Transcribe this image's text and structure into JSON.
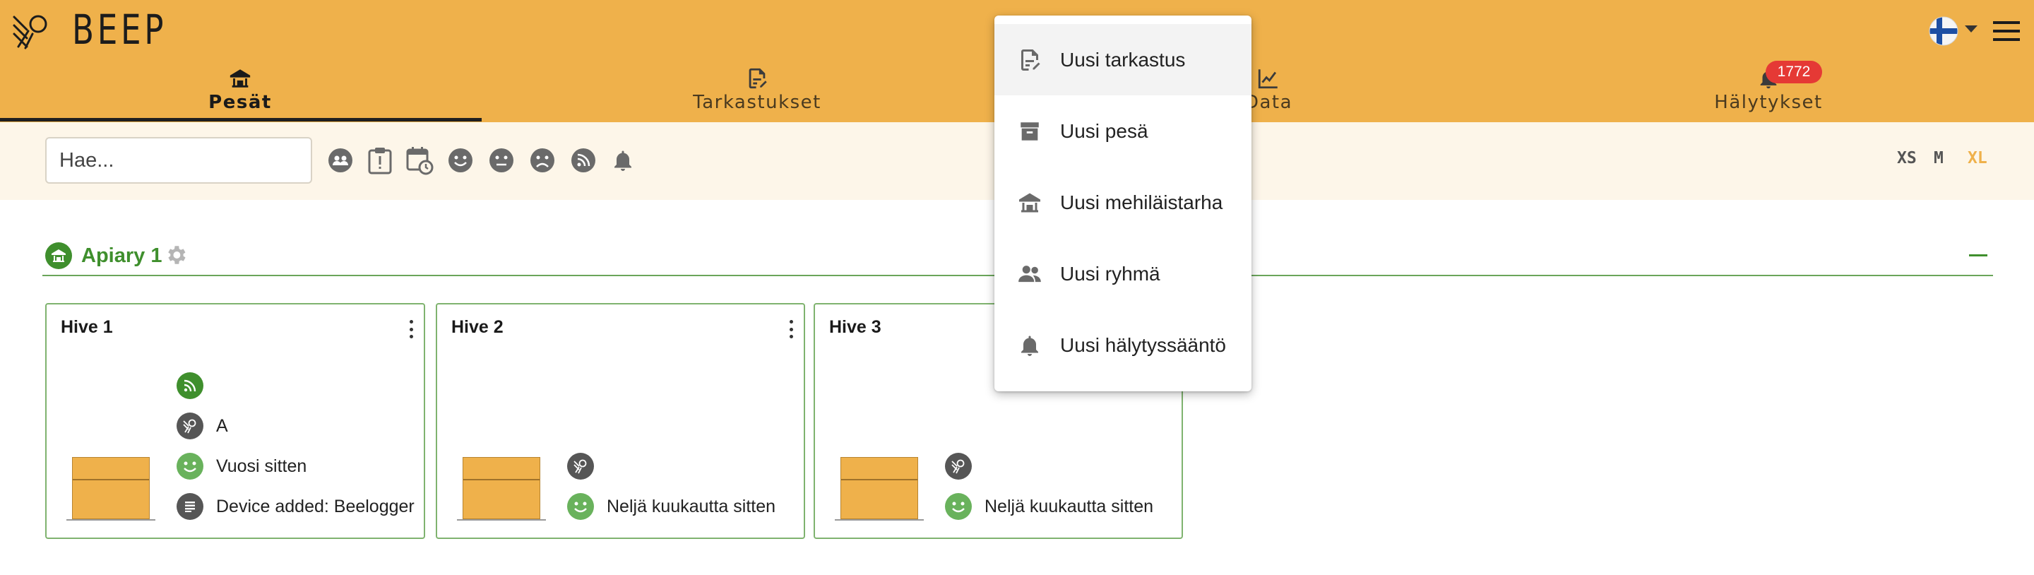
{
  "app": {
    "brand": "BEEP",
    "language": "Finnish"
  },
  "nav": {
    "tabs": [
      {
        "label": "Pesät",
        "icon": "apiary-home-icon",
        "active": true
      },
      {
        "label": "Tarkastukset",
        "icon": "inspection-edit-icon",
        "active": false
      },
      {
        "label": "Data",
        "icon": "chart-line-icon",
        "active": false
      },
      {
        "label": "Hälytykset",
        "icon": "bell-icon",
        "active": false
      }
    ],
    "alerts_badge": "1772"
  },
  "filters": {
    "search_placeholder": "Hae...",
    "icons": [
      "group-icon",
      "clipboard-alert-icon",
      "calendar-clock-icon",
      "smiley-happy-icon",
      "smiley-neutral-icon",
      "smiley-sad-icon",
      "sensor-rss-icon",
      "bell-icon"
    ],
    "sizes": [
      "XS",
      "M",
      "XL"
    ],
    "active_size": "XL"
  },
  "apiary": {
    "name": "Apiary 1"
  },
  "hives": [
    {
      "name": "Hive 1",
      "rows": [
        {
          "icon": "sensor-rss-icon",
          "color": "#3f8f2d",
          "text": ""
        },
        {
          "icon": "bee-queen-icon",
          "color": "#565656",
          "text": "A"
        },
        {
          "icon": "smiley-happy-icon",
          "color": "#69b25c",
          "text": "Vuosi sitten"
        },
        {
          "icon": "note-icon",
          "color": "#565656",
          "text": "Device added: Beelogger"
        }
      ]
    },
    {
      "name": "Hive 2",
      "rows": [
        {
          "icon": "bee-queen-icon",
          "color": "#565656",
          "text": ""
        },
        {
          "icon": "smiley-happy-icon",
          "color": "#69b25c",
          "text": "Neljä kuukautta sitten"
        }
      ]
    },
    {
      "name": "Hive 3",
      "rows": [
        {
          "icon": "bee-queen-icon",
          "color": "#565656",
          "text": ""
        },
        {
          "icon": "smiley-happy-icon",
          "color": "#69b25c",
          "text": "Neljä kuukautta sitten"
        }
      ]
    }
  ],
  "menu": {
    "items": [
      {
        "label": "Uusi tarkastus",
        "icon": "inspection-edit-icon"
      },
      {
        "label": "Uusi pesä",
        "icon": "hive-box-icon"
      },
      {
        "label": "Uusi mehiläistarha",
        "icon": "apiary-home-icon"
      },
      {
        "label": "Uusi ryhmä",
        "icon": "group-icon"
      },
      {
        "label": "Uusi hälytyssääntö",
        "icon": "bell-icon"
      }
    ]
  },
  "colors": {
    "header": "#efb14b",
    "filterbar": "#fdf6e9",
    "green": "#3f8f2d",
    "badge": "#e53935"
  }
}
